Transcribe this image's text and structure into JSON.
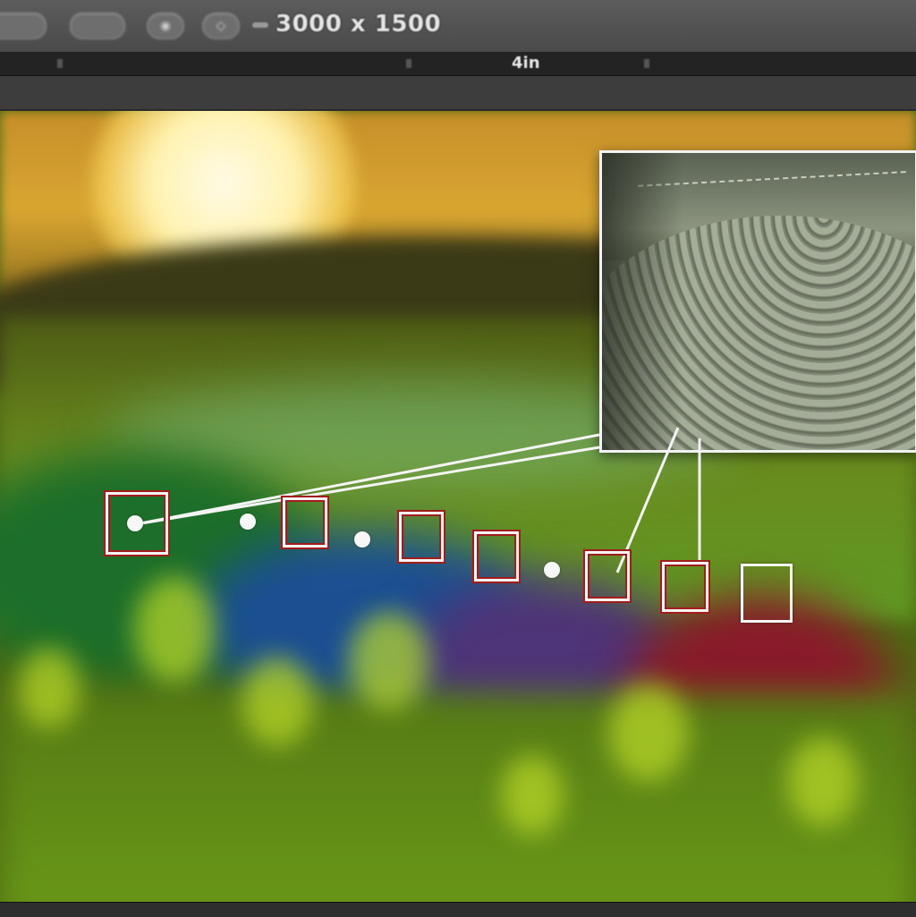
{
  "toolbar": {
    "buttons": [
      {
        "name": "tool-button-1"
      },
      {
        "name": "tool-button-2"
      },
      {
        "name": "tool-button-3",
        "icon": "camera-icon"
      },
      {
        "name": "tool-button-4",
        "icon": "crop-icon"
      }
    ],
    "dimensions_readout": "3000 x 1500"
  },
  "ruler": {
    "center_label": "4in"
  },
  "canvas": {
    "description_colors": {
      "sky": "#d9a631",
      "field": "#6a8a1e",
      "accent_marker": "#a31c1c"
    }
  },
  "inset": {
    "subject": "fabric-brim-closeup"
  },
  "markers": {
    "count": 8,
    "dots": 3
  }
}
